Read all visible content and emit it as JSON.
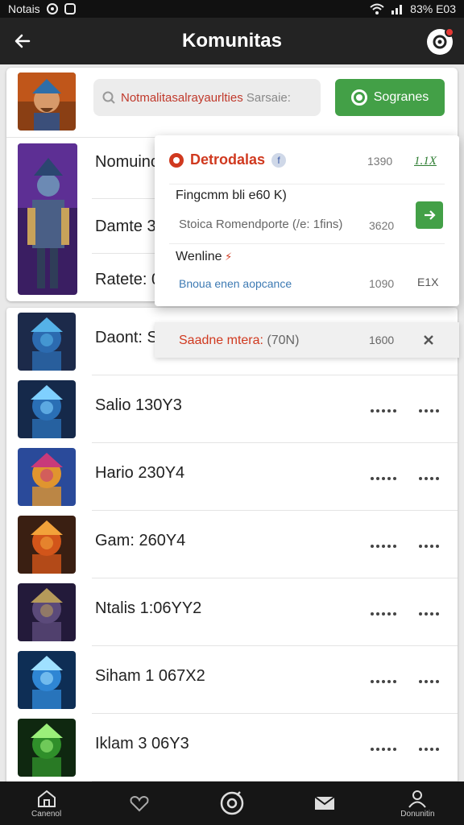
{
  "status_bar": {
    "carrier": "Notais",
    "right_text": "83% E03"
  },
  "app_bar": {
    "title": "Komunitas"
  },
  "search": {
    "placeholder_red": "Notmalitasalrayaurlties",
    "placeholder_grey": "Sarsaie:"
  },
  "primary_button": {
    "label": "Sogranes"
  },
  "card_rows": [
    {
      "label": "Nomuinc"
    },
    {
      "label": "Damte 3"
    },
    {
      "label": "Ratete: 0"
    }
  ],
  "popup": {
    "title": "Detrodalas",
    "title_number": "1390",
    "title_link": "1.1X",
    "line1": "Fingcmm bli e60 K)",
    "line2": "Stoica Romendporte (/e: 1fins)",
    "line2_number": "3620",
    "line3": "Wenline",
    "line4": "Bnoua enen aopcance",
    "line4_number": "1090",
    "line4_tail": "E1X"
  },
  "strip": {
    "label": "Saadne mtera: ",
    "label_num": "(70N)",
    "number": "1600"
  },
  "list": [
    {
      "name": "Daont: S",
      "palette": [
        "#1c2a4a",
        "#2c6bb0",
        "#55b2e8"
      ]
    },
    {
      "name": "Salio 130Y3",
      "palette": [
        "#15294a",
        "#2a6fb5",
        "#7fd0ff"
      ]
    },
    {
      "name": "Hario 230Y4",
      "palette": [
        "#2a4a9a",
        "#e0952f",
        "#c83a7a"
      ]
    },
    {
      "name": "Gam: 260Y4",
      "palette": [
        "#3a1f12",
        "#d2551a",
        "#f2a23a"
      ]
    },
    {
      "name": "Ntalis 1:06YY2",
      "palette": [
        "#231a3a",
        "#5b4a7a",
        "#b59a5a"
      ]
    },
    {
      "name": "Siham 1 067X2",
      "palette": [
        "#0e2e55",
        "#2f86d4",
        "#9fe0ff"
      ]
    },
    {
      "name": "Iklam 3 06Y3",
      "palette": [
        "#0f2810",
        "#2f8f2a",
        "#9bf07a"
      ]
    }
  ],
  "bottom_nav": [
    {
      "label": "Canenol",
      "icon": "home-icon"
    },
    {
      "label": "",
      "icon": "heart-icon"
    },
    {
      "label": "",
      "icon": "compass-icon"
    },
    {
      "label": "",
      "icon": "mail-icon"
    },
    {
      "label": "Donunitin",
      "icon": "profile-icon"
    }
  ],
  "colors": {
    "accent_green": "#43a047",
    "accent_red": "#d0391f",
    "bar": "#232323"
  }
}
